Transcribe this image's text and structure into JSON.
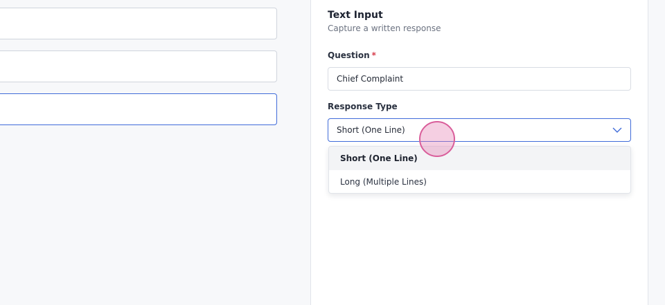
{
  "panel": {
    "title": "Text Input",
    "subtitle": "Capture a written response"
  },
  "question": {
    "label": "Question",
    "required_mark": "*",
    "value": "Chief Complaint"
  },
  "response_type": {
    "label": "Response Type",
    "selected": "Short (One Line)",
    "options": [
      {
        "label": "Short (One Line)"
      },
      {
        "label": "Long (Multiple Lines)"
      }
    ]
  },
  "icons": {
    "select_toggle": "chevron-down-icon"
  },
  "colors": {
    "accent": "#3f6bd9",
    "required": "#d63b4a",
    "click_indicator": "#d95d9a"
  }
}
